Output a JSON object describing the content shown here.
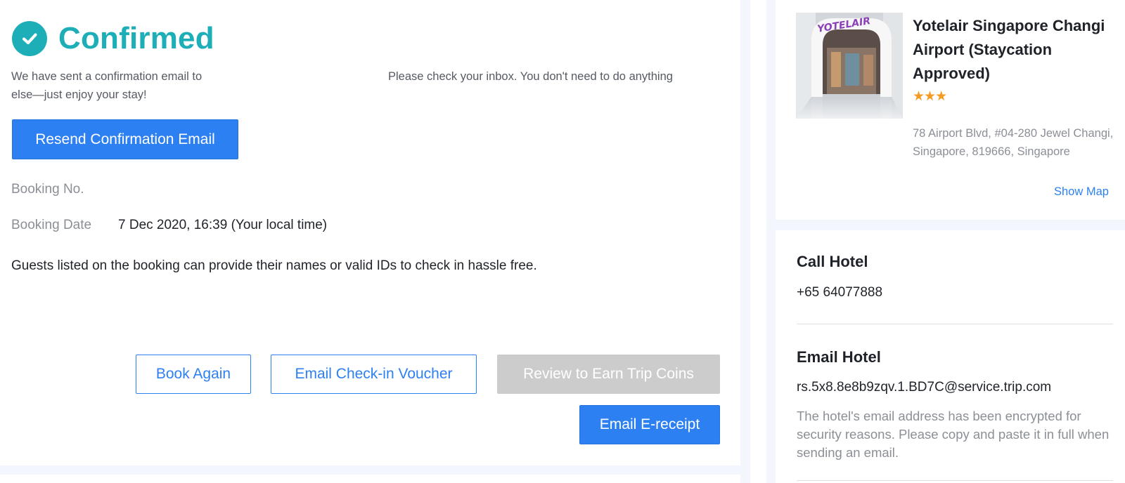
{
  "header": {
    "title": "Confirmed",
    "message_part1": "We have sent a confirmation email to",
    "message_part2": "Please check your inbox. You don't need to do anything",
    "message_part3": "else—just enjoy your stay!"
  },
  "buttons": {
    "resend": "Resend Confirmation Email",
    "book_again": "Book Again",
    "email_voucher": "Email Check-in Voucher",
    "review": "Review to Earn Trip Coins",
    "email_receipt": "Email E-receipt"
  },
  "booking": {
    "number_label": "Booking No.",
    "date_label": "Booking Date",
    "date_value": "7 Dec 2020, 16:39 (Your local time)",
    "guests_note": "Guests listed on the booking can provide their names or valid IDs to check in hassle free."
  },
  "hotel": {
    "name": "Yotelair Singapore Changi Airport (Staycation Approved)",
    "stars_display": "★★★",
    "star_rating": 3,
    "address": "78 Airport Blvd, #04-280 Jewel Changi, Singapore, 819666, Singapore",
    "show_map": "Show Map",
    "sign_text": "YOTELAIR"
  },
  "contact": {
    "call_title": "Call Hotel",
    "phone": "+65 64077888",
    "email_title": "Email Hotel",
    "email": "rs.5x8.8e8b9zqv.1.BD7C@service.trip.com",
    "email_note": "The hotel's email address has been encrypted for security reasons. Please copy and paste it in full when sending an email."
  },
  "colors": {
    "brand_teal": "#1eaeb8",
    "primary_blue": "#2d80f2",
    "disabled_gray": "#cccccc",
    "star_orange": "#f59b23",
    "page_background": "#f3f7fd"
  },
  "icons": {
    "confirmed": "check-circle-icon"
  }
}
